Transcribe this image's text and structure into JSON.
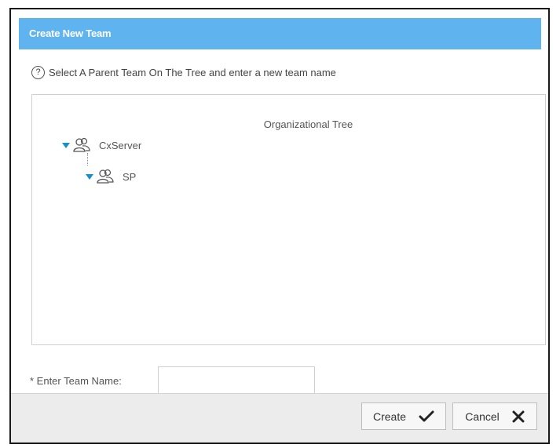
{
  "dialog": {
    "title": "Create New Team",
    "help_text": "Select A Parent Team On The Tree and enter a new team name"
  },
  "tree": {
    "title": "Organizational Tree",
    "nodes": [
      {
        "label": "CxServer",
        "expanded": true,
        "icon": "team-icon"
      },
      {
        "label": "SP",
        "expanded": true,
        "icon": "team-icon"
      }
    ]
  },
  "form": {
    "team_name_label": "* Enter Team Name:",
    "team_name_value": ""
  },
  "buttons": {
    "create_label": "Create",
    "cancel_label": "Cancel"
  },
  "colors": {
    "titlebar": "#5fb3ef",
    "tree_arrow": "#1a8fc4"
  }
}
